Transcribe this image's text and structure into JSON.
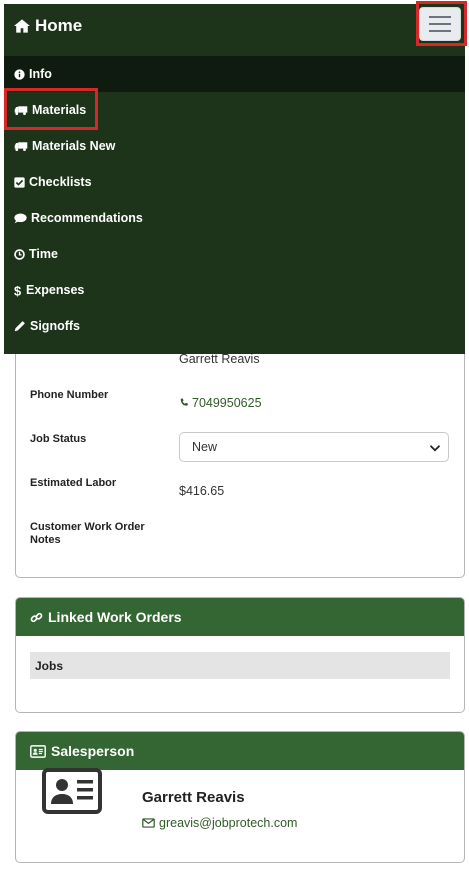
{
  "navbar": {
    "brand_label": "Home",
    "toggle_label": "menu"
  },
  "menu": {
    "items": [
      {
        "label": "Info",
        "icon": "info-circle-icon"
      },
      {
        "label": "Materials",
        "icon": "truck-icon"
      },
      {
        "label": "Materials New",
        "icon": "truck-icon"
      },
      {
        "label": "Checklists",
        "icon": "check-square-icon"
      },
      {
        "label": "Recommendations",
        "icon": "comment-icon"
      },
      {
        "label": "Time",
        "icon": "clock-icon"
      },
      {
        "label": "Expenses",
        "icon": "dollar-icon"
      },
      {
        "label": "Signoffs",
        "icon": "pencil-icon"
      }
    ]
  },
  "details": {
    "contact_value": "Garrett Reavis",
    "phone_label": "Phone Number",
    "phone_value": "7049950625",
    "status_label": "Job Status",
    "status_value": "New",
    "labor_label": "Estimated Labor",
    "labor_value": "$416.65",
    "notes_label_line1": "Customer Work Order",
    "notes_label_line2": "Notes"
  },
  "linked": {
    "title": "Linked Work Orders",
    "jobs_label": "Jobs"
  },
  "salesperson": {
    "title": "Salesperson",
    "name": "Garrett Reavis",
    "email": "greavis@jobprotech.com"
  },
  "colors": {
    "navbar": "#1d341b",
    "card_header": "#336633",
    "highlight": "#d62828",
    "link": "#2f5b27"
  }
}
